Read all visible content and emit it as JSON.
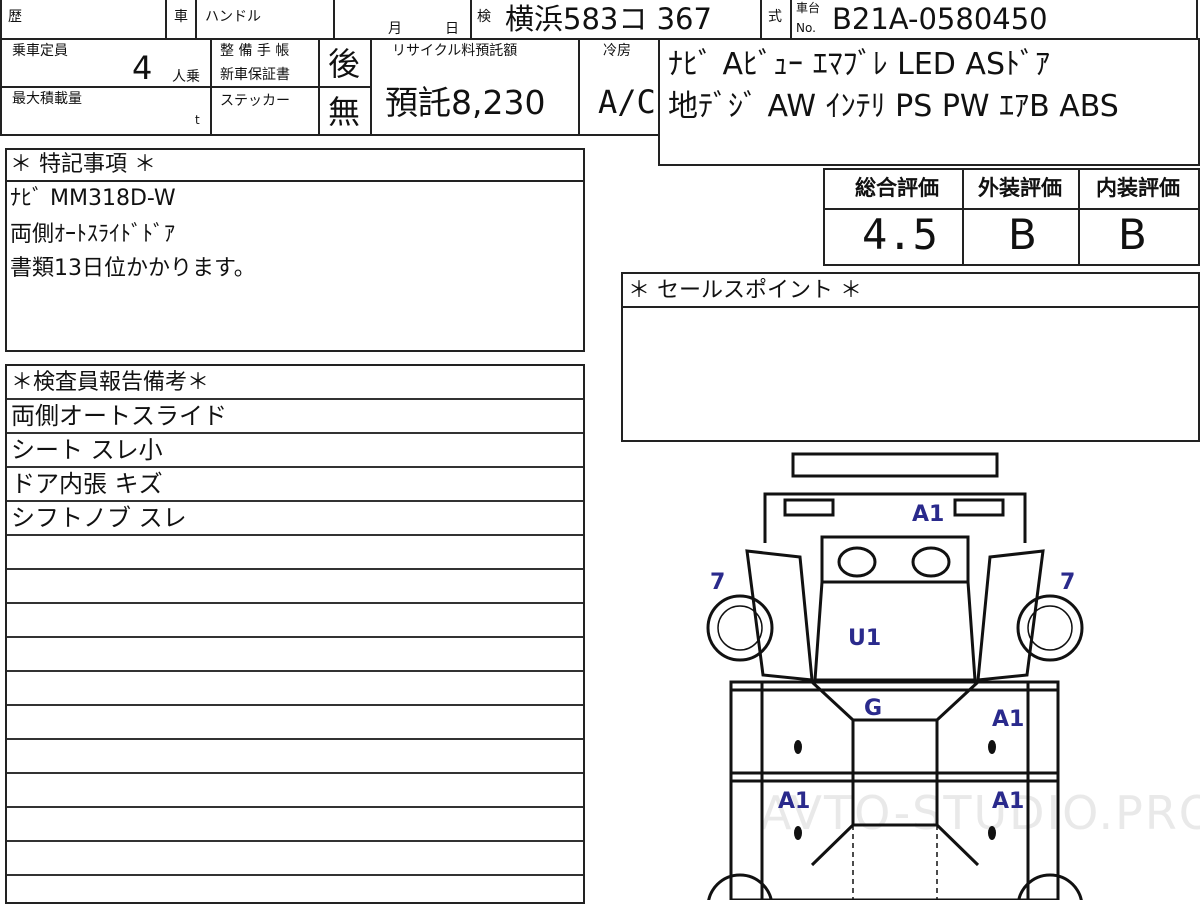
{
  "header": {
    "history_label": "歴",
    "car_label": "車",
    "handle_label": "ハンドル",
    "month_label": "月",
    "day_label": "日",
    "inspection_label": "検",
    "plate": "横浜583コ 367",
    "model_label": "式",
    "chassis_label_top": "車台",
    "chassis_label_no": "No.",
    "chassis_no": "B21A-0580450"
  },
  "specs": {
    "capacity_label": "乗車定員",
    "capacity_value": "4",
    "capacity_unit": "人乗",
    "max_load_label": "最大積載量",
    "max_load_unit": "t",
    "warranty_label_1": "整 備 手 帳",
    "warranty_label_2": "新車保証書",
    "warranty_value": "後",
    "sticker_label": "ステッカー",
    "sticker_value": "無",
    "recycle_label": "リサイクル料預託額",
    "recycle_value": "預託8,230",
    "cooling_label": "冷房",
    "cooling_value": "A/C",
    "equipment_line1": "ﾅﾋﾞ Aﾋﾞｭｰ ｴﾏﾌﾞﾚ LED ASﾄﾞｱ",
    "equipment_line2": "地ﾃﾞｼﾞ AW ｲﾝﾃﾘ PS PW ｴｱB ABS"
  },
  "ratings": {
    "overall_label": "総合評価",
    "overall_value": "4.5",
    "exterior_label": "外装評価",
    "exterior_value": "B",
    "interior_label": "内装評価",
    "interior_value": "B"
  },
  "notes": {
    "title": "＊ 特記事項 ＊",
    "lines": [
      "ﾅﾋﾞ MM318D-W",
      "両側ｵｰﾄｽﾗｲﾄﾞﾄﾞｱ",
      "書類13日位かかります。"
    ]
  },
  "sales": {
    "title": "＊ セールスポイント ＊"
  },
  "inspector": {
    "title": "＊検査員報告備考＊",
    "lines": [
      "両側オートスライド",
      "シート スレ小",
      "ドア内張 キズ",
      "シフトノブ スレ"
    ]
  },
  "diagram": {
    "marks": [
      "A1",
      "7",
      "7",
      "U1",
      "G",
      "A1",
      "A1",
      "A1"
    ]
  },
  "watermark": "AVTO-STUDIO.PRO"
}
